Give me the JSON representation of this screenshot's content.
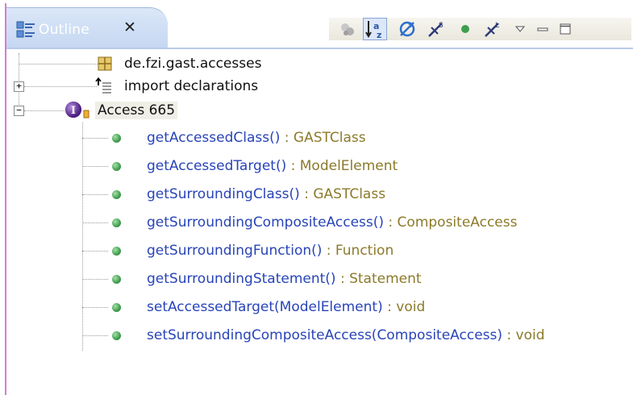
{
  "view": {
    "title": "Outline",
    "close_glyph": "✕",
    "toolbar_icons": [
      "hide-fields-icon",
      "sort-alphabetically-icon",
      "hide-static-icon",
      "hide-non-public-icon",
      "public-filter-icon",
      "hide-local-types-icon",
      "view-menu-chevron-icon",
      "minimize-icon",
      "maximize-icon"
    ]
  },
  "tree": {
    "package": "de.fzi.gast.accesses",
    "imports": "import declarations",
    "imports_expander": "+",
    "type_node": "Access 665",
    "type_expander": "−",
    "methods": [
      {
        "name": "getAccessedClass()",
        "type": " : GASTClass"
      },
      {
        "name": "getAccessedTarget()",
        "type": " : ModelElement"
      },
      {
        "name": "getSurroundingClass()",
        "type": " : GASTClass"
      },
      {
        "name": "getSurroundingCompositeAccess()",
        "type": " : CompositeAccess"
      },
      {
        "name": "getSurroundingFunction()",
        "type": " : Function"
      },
      {
        "name": "getSurroundingStatement()",
        "type": " : Statement"
      },
      {
        "name": "setAccessedTarget(ModelElement)",
        "type": " : void"
      },
      {
        "name": "setSurroundingCompositeAccess(CompositeAccess)",
        "type": " : void"
      }
    ]
  },
  "colors": {
    "method_name": "#2844b8",
    "method_type": "#8c7a2a",
    "tab_gradient_top": "#dbe7f8",
    "public_method_dot": "#3e9e4e"
  }
}
